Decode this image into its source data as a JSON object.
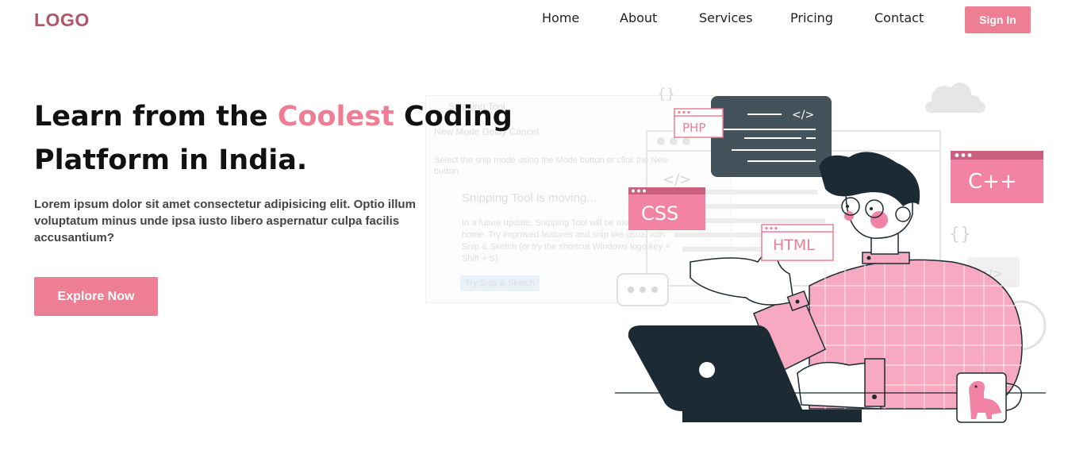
{
  "brand": {
    "logo": "LOGO"
  },
  "nav": {
    "items": [
      "Home",
      "About",
      "Services",
      "Pricing",
      "Contact"
    ],
    "signin_label": "Sign In"
  },
  "hero": {
    "headline_before": "Learn from the ",
    "headline_accent": "Coolest",
    "headline_after": " Coding Platform in India.",
    "lead": "Lorem ipsum dolor sit amet consectetur adipisicing elit. Optio illum voluptatum minus unde ipsa iusto libero aspernatur culpa facilis accusantium?",
    "cta_label": "Explore Now"
  },
  "ghost_window": {
    "title": "Snipping Tool",
    "toolbar": "New   Mode   Delay   Cancel",
    "tip": "Select the snip mode using the Mode button or click the New button.",
    "heading": "Snipping Tool is moving...",
    "body": "In a future update, Snipping Tool will be moving to a new home. Try improved features and snip like usual with Snip & Sketch (or try the shortcut Windows logo key + Shift + S).",
    "button": "Try Snip & Sketch"
  },
  "illustration": {
    "tags": {
      "php": "PHP",
      "css": "CSS",
      "html": "HTML",
      "cpp": "C++",
      "code_tag": "</>",
      "braces": "{}"
    }
  },
  "colors": {
    "accent": "#ee7e93",
    "logo": "#b25569",
    "dark": "#1c2a33",
    "slate": "#44525c",
    "pink_light": "#f6a9c0"
  }
}
